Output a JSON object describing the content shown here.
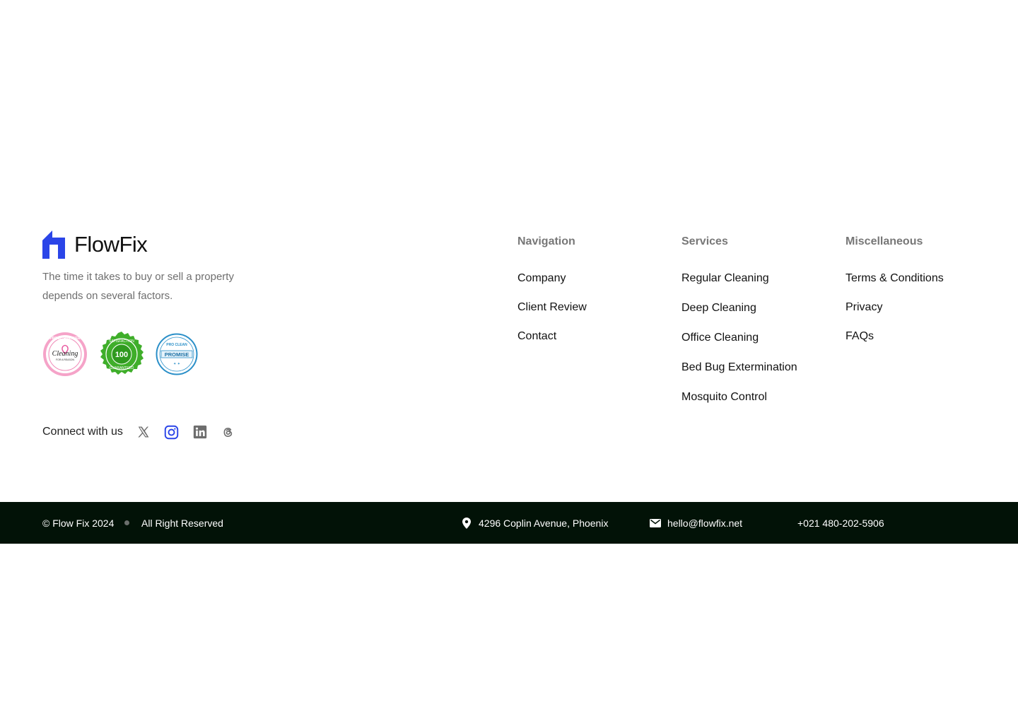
{
  "brand": {
    "name": "FlowFix",
    "tagline": "The time it takes to buy or sell a property depends on several factors.",
    "logo_color": "#2b45e8"
  },
  "badges": [
    {
      "name": "proud-partner-cleaning-for-a-reason-badge",
      "text_lines": [
        "PROUD PARTNER",
        "Cleaning",
        "FOR A REASON"
      ],
      "color": "#e85aa0"
    },
    {
      "name": "satisfaction-guaranteed-badge",
      "text_lines": [
        "SATISFACTION",
        "100%",
        "GUARANTEED"
      ],
      "color": "#3fae2a"
    },
    {
      "name": "pro-clean-promise-badge",
      "text_lines": [
        "PRO CLEAN",
        "PROMISE"
      ],
      "color": "#2a8fc8"
    }
  ],
  "connect": {
    "label": "Connect with us",
    "icons": [
      "x-icon",
      "instagram-icon",
      "linkedin-icon",
      "threads-icon"
    ],
    "instagram_color": "#2b45e8",
    "icon_color": "#6d6d6d"
  },
  "columns": {
    "navigation": {
      "heading": "Navigation",
      "links": [
        "Company",
        "Client Review",
        "Contact"
      ]
    },
    "services": {
      "heading": "Services",
      "links": [
        "Regular Cleaning",
        "Deep Cleaning",
        "Office Cleaning",
        "Bed Bug Extermination",
        "Mosquito Control"
      ]
    },
    "misc": {
      "heading": "Miscellaneous",
      "links": [
        "Terms & Conditions",
        "Privacy",
        "FAQs"
      ]
    }
  },
  "bottom_bar": {
    "copyright": "© Flow Fix 2024",
    "rights": "All Right Reserved",
    "address": "4296 Coplin Avenue, Phoenix",
    "email": "hello@flowfix.net",
    "phone": "+021 480-202-5906",
    "background": "#021207"
  }
}
